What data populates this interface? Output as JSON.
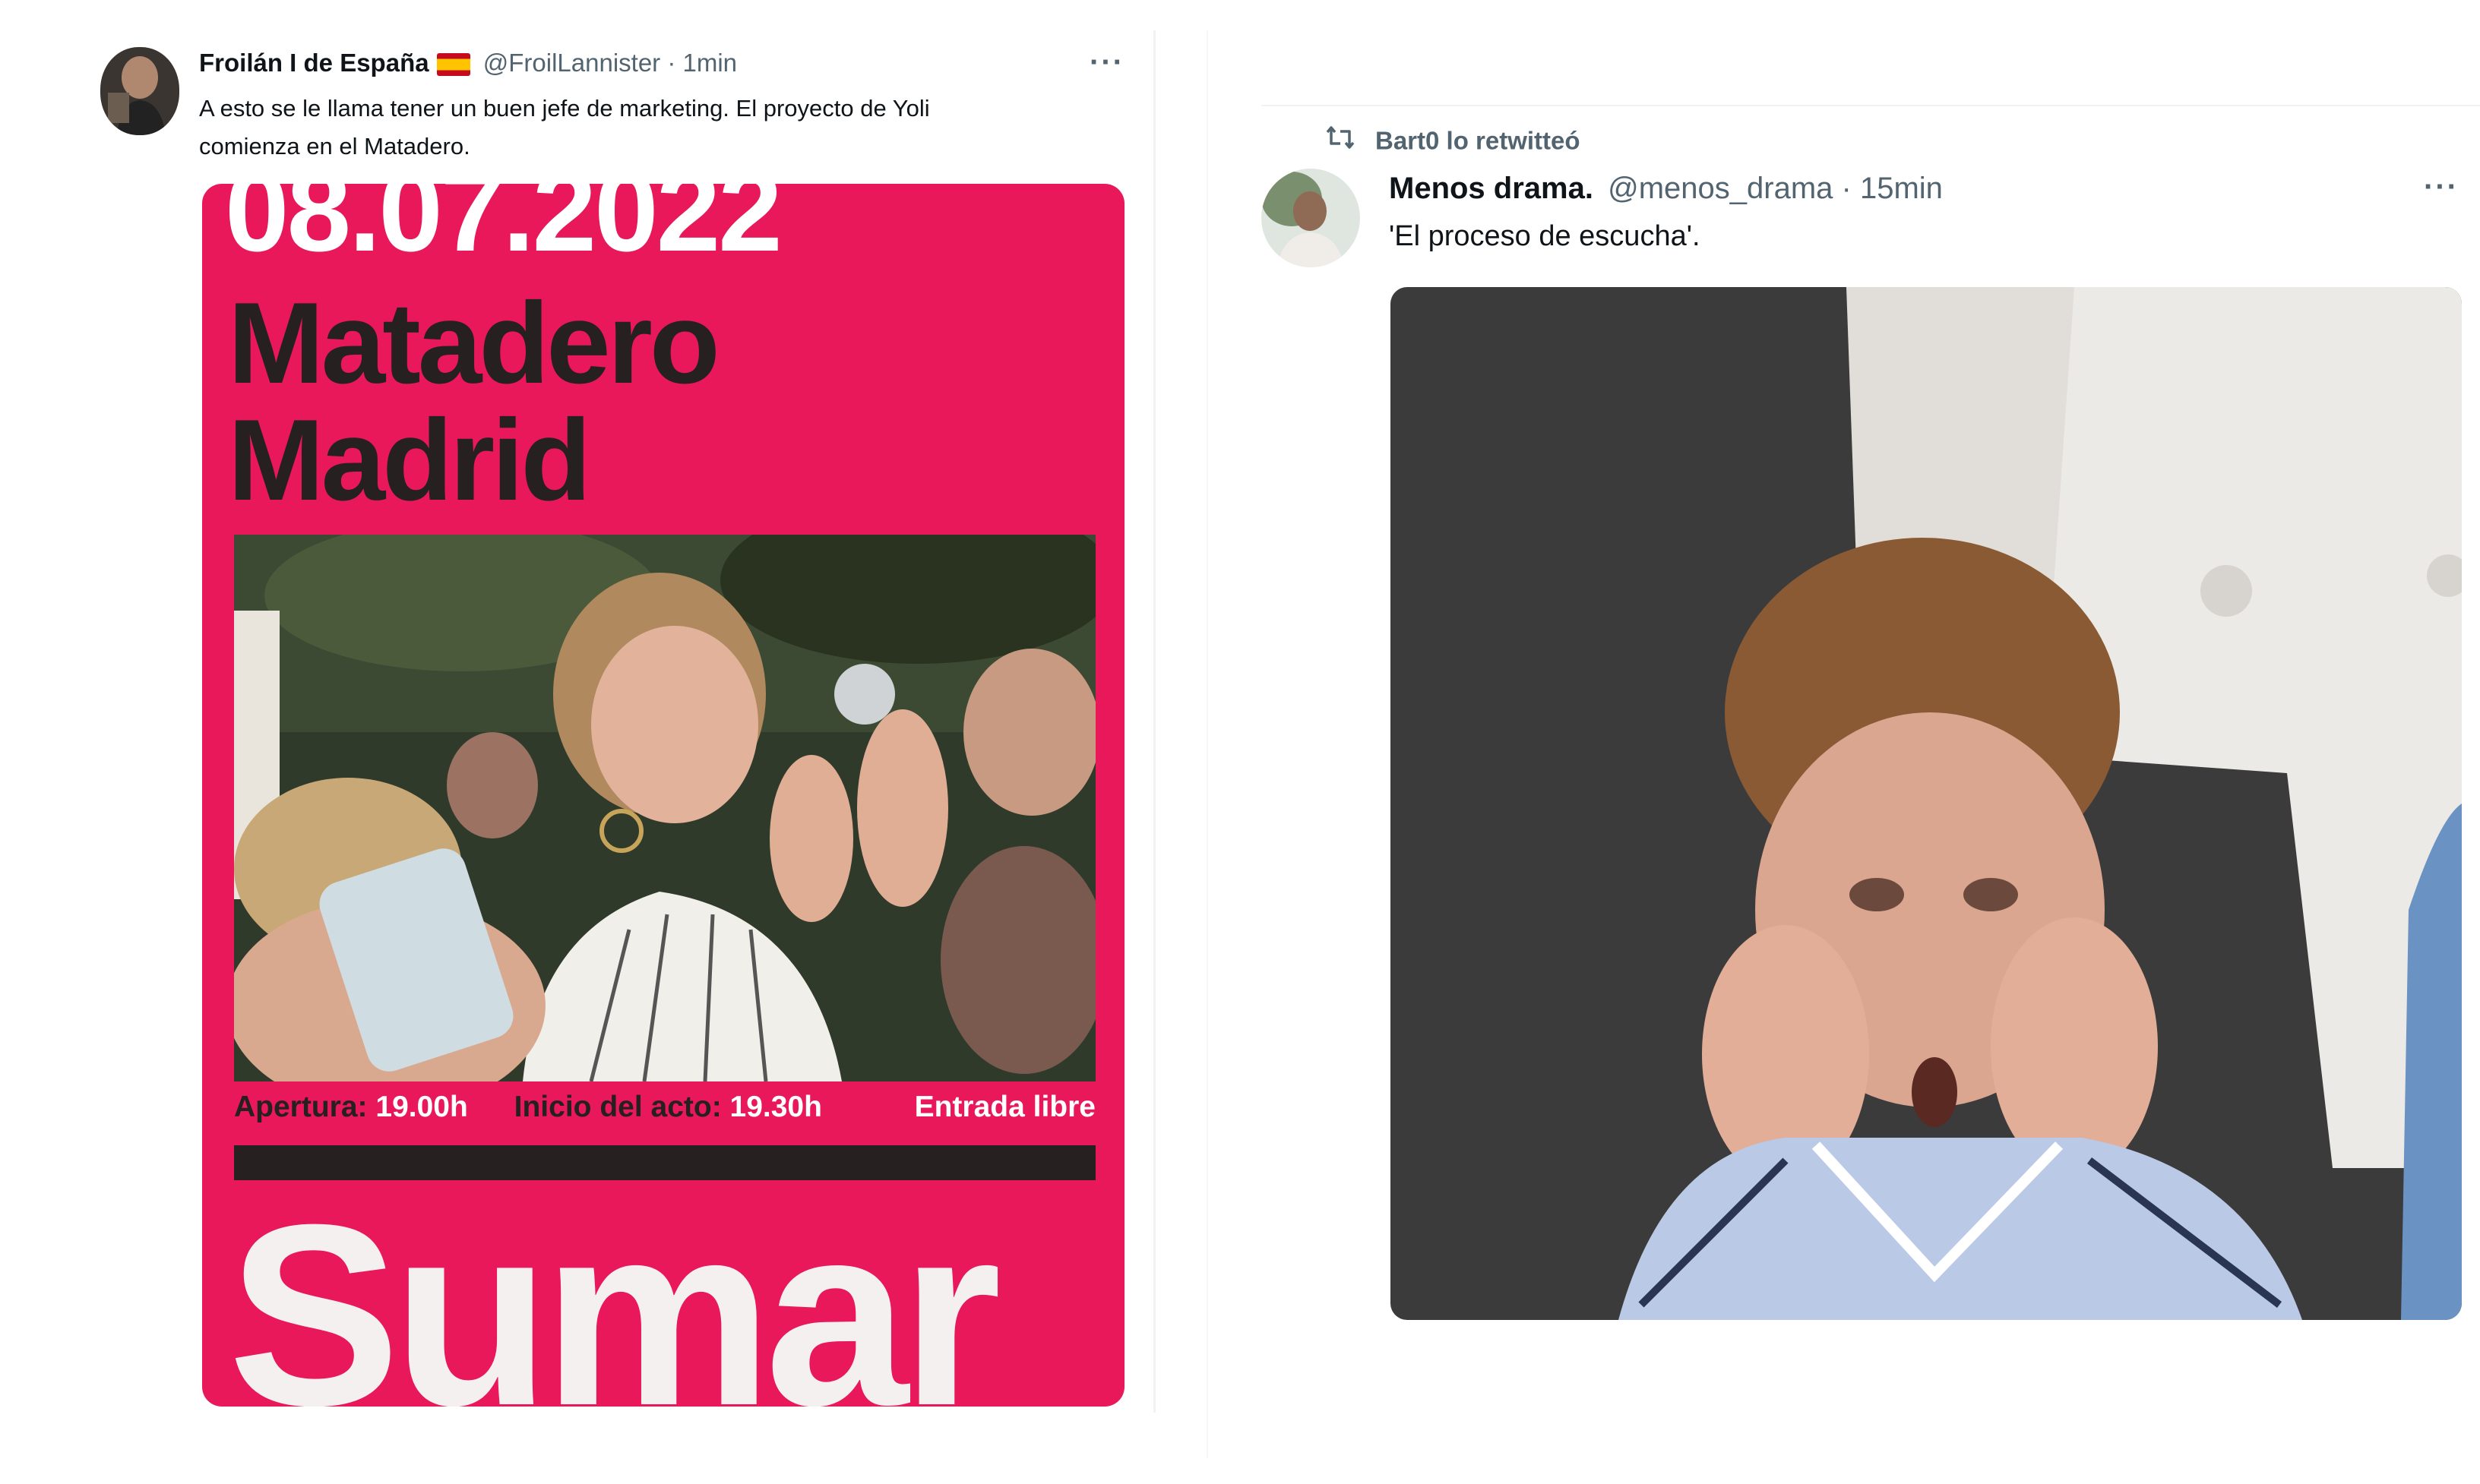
{
  "tweet_left": {
    "author_name": "Froilán I de España",
    "author_flag": "flag-spain-icon",
    "handle": "@FroilLannister",
    "time": "· 1min",
    "text_line1": "A esto se le llama tener un buen jefe de marketing. El proyecto de Yoli",
    "text_line2": "comienza en el Matadero.",
    "poster": {
      "date": "08.07.2022",
      "venue_line1": "Matadero",
      "venue_line2": "Madrid",
      "apertura_label": "Apertura:",
      "apertura_time": "19.00h",
      "inicio_label": "Inicio del acto:",
      "inicio_time": "19.30h",
      "entrada": "Entrada libre",
      "brand": "Sumar",
      "background_color": "#e8185a"
    }
  },
  "tweet_right": {
    "retweet_label": "Bart0 lo retwitteó",
    "author_name": "Menos drama.",
    "handle": "@menos_drama",
    "time": "· 15min",
    "text": "'El proceso de escucha'."
  },
  "icons": {
    "more": "more-horizontal-icon",
    "retweet": "retweet-icon"
  },
  "more_glyph": "···"
}
